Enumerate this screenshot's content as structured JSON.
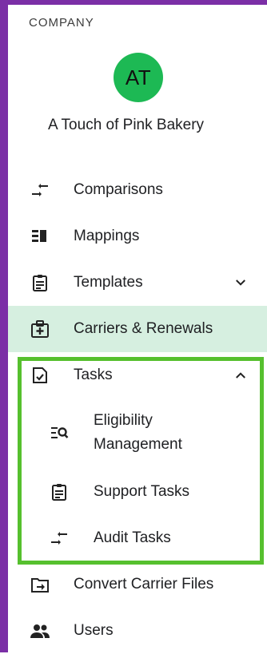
{
  "sidebar": {
    "section_label": "COMPANY",
    "avatar_initials": "AT",
    "avatar_color": "#1db954",
    "company_name": "A Touch of Pink Bakery",
    "items": [
      {
        "label": "Comparisons",
        "icon": "compare-arrows-icon"
      },
      {
        "label": "Mappings",
        "icon": "mappings-icon"
      },
      {
        "label": "Templates",
        "icon": "clipboard-icon",
        "chevron": "chevron-down-icon"
      },
      {
        "label": "Carriers & Renewals",
        "icon": "medical-id-icon",
        "active": true
      },
      {
        "label": "Tasks",
        "icon": "task-check-icon",
        "chevron": "chevron-up-icon",
        "expanded": true
      },
      {
        "label": "Convert Carrier Files",
        "icon": "folder-arrow-icon"
      },
      {
        "label": "Users",
        "icon": "users-icon"
      }
    ],
    "task_subitems": [
      {
        "label": "Eligibility Management",
        "icon": "list-search-icon"
      },
      {
        "label": "Support Tasks",
        "icon": "clipboard-icon"
      },
      {
        "label": "Audit Tasks",
        "icon": "compare-arrows-icon"
      }
    ]
  },
  "colors": {
    "active_bg": "#d6efe0",
    "highlight_border": "#56c02e",
    "frame": "#7b2fa6"
  }
}
